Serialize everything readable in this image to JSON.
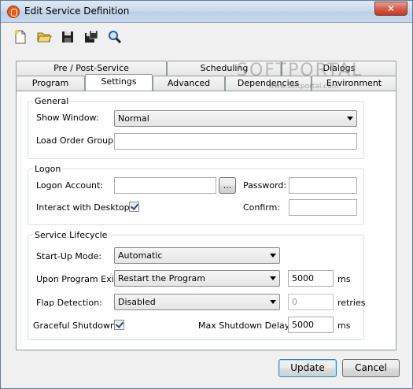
{
  "window": {
    "title": "Edit Service Definition",
    "close_label": "✕"
  },
  "toolbar": {
    "icons": [
      "new-icon",
      "open-icon",
      "save-icon",
      "save-as-icon",
      "find-icon"
    ]
  },
  "tabs": {
    "row1": [
      "Pre / Post-Service",
      "Scheduling",
      "Dialogs"
    ],
    "row2": [
      "Program",
      "Settings",
      "Advanced",
      "Dependencies",
      "Environment"
    ],
    "active": "Settings"
  },
  "watermark": {
    "text": "SOFTPORTAL",
    "sub": "www.softportal.com"
  },
  "general": {
    "title": "General",
    "show_window_label": "Show Window:",
    "show_window_value": "Normal",
    "load_order_label": "Load Order Group:",
    "load_order_value": ""
  },
  "logon": {
    "title": "Logon",
    "account_label": "Logon Account:",
    "account_value": "",
    "browse_label": "...",
    "password_label": "Password:",
    "password_value": "",
    "interact_label": "Interact with Desktop:",
    "interact_checked": true,
    "confirm_label": "Confirm:",
    "confirm_value": ""
  },
  "lifecycle": {
    "title": "Service Lifecycle",
    "startup_label": "Start-Up Mode:",
    "startup_value": "Automatic",
    "exit_label": "Upon Program Exit:",
    "exit_value": "Restart the Program",
    "exit_ms_value": "5000",
    "exit_ms_unit": "ms",
    "flap_label": "Flap Detection:",
    "flap_value": "Disabled",
    "retries_value": "0",
    "retries_unit": "retries",
    "graceful_label": "Graceful Shutdown:",
    "graceful_checked": true,
    "max_delay_label": "Max Shutdown Delay:",
    "max_delay_value": "5000",
    "max_delay_unit": "ms"
  },
  "buttons": {
    "update": "Update",
    "cancel": "Cancel"
  }
}
